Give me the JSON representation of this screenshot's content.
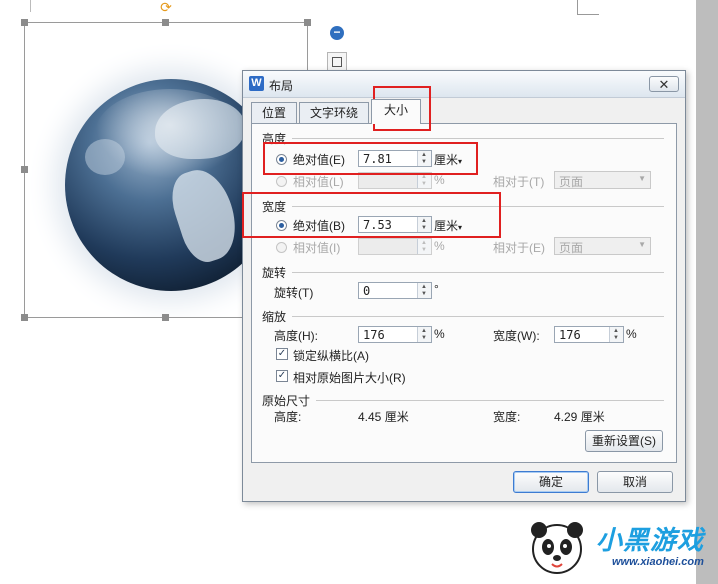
{
  "dialog": {
    "title": "布局",
    "close_icon": "close-icon",
    "tabs": [
      {
        "label": "位置"
      },
      {
        "label": "文字环绕"
      },
      {
        "label": "大小"
      }
    ],
    "height_section": {
      "title": "高度",
      "absolute_label": "绝对值(E)",
      "absolute_value": "7.81",
      "absolute_unit": "厘米",
      "relative_label": "相对值(L)",
      "relative_value": "",
      "relative_unit": "%",
      "relative_to_label": "相对于(T)",
      "relative_to_value": "页面"
    },
    "width_section": {
      "title": "宽度",
      "absolute_label": "绝对值(B)",
      "absolute_value": "7.53",
      "absolute_unit": "厘米",
      "relative_label": "相对值(I)",
      "relative_value": "",
      "relative_unit": "%",
      "relative_to_label": "相对于(E)",
      "relative_to_value": "页面"
    },
    "rotate_section": {
      "title": "旋转",
      "rotate_label": "旋转(T)",
      "rotate_value": "0",
      "rotate_unit": "°"
    },
    "scale_section": {
      "title": "缩放",
      "height_label": "高度(H):",
      "height_value": "176",
      "height_unit": "%",
      "width_label": "宽度(W):",
      "width_value": "176",
      "width_unit": "%",
      "lock_aspect_label": "锁定纵横比(A)",
      "lock_aspect_checked": true,
      "relative_original_label": "相对原始图片大小(R)",
      "relative_original_checked": true
    },
    "original_section": {
      "title": "原始尺寸",
      "height_label": "高度:",
      "height_value": "4.45 厘米",
      "width_label": "宽度:",
      "width_value": "4.29 厘米",
      "reset_label": "重新设置(S)"
    },
    "ok_label": "确定",
    "cancel_label": "取消"
  },
  "canvas": {
    "rotate_icon": "rotate-icon",
    "side_minus_icon": "minus-circle-icon",
    "side_layout_icon": "layout-options-icon"
  },
  "watermark": {
    "brand": "小黑游戏",
    "site": "www.xiaohei.com"
  },
  "colors": {
    "highlight_box": "#e02020",
    "accent_blue": "#2b5ea0",
    "watermark_blue": "#1d9fe0"
  }
}
